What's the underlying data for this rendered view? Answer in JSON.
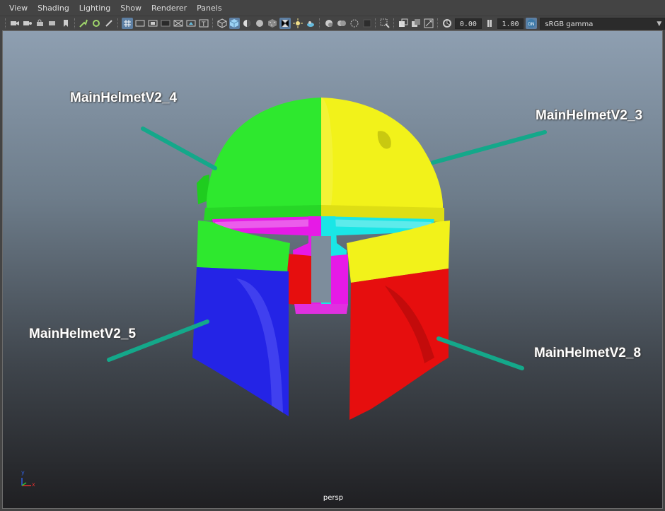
{
  "menubar": {
    "items": [
      "View",
      "Shading",
      "Lighting",
      "Show",
      "Renderer",
      "Panels"
    ]
  },
  "toolbar": {
    "exposure_value": "0.00",
    "gamma_value": "1.00",
    "color_space": "sRGB gamma",
    "icons": [
      "camera-icon",
      "camera-attributes-icon",
      "bookmark-icon",
      "image-plane-icon",
      "grid-icon",
      "film-gate-icon",
      "resolution-gate-icon",
      "gate-mask-icon",
      "field-chart-icon",
      "safe-action-icon",
      "safe-title-icon",
      "wireframe-icon",
      "smooth-shade-icon",
      "default-lighting-icon",
      "textured-icon",
      "use-all-lights-icon",
      "shadows-icon",
      "screen-space-ao-icon",
      "motion-blur-icon",
      "multisample-aa-icon",
      "depth-of-field-icon",
      "isolate-select-icon",
      "xray-icon",
      "xray-joints-icon",
      "backface-culling-icon",
      "exposure-icon",
      "gamma-icon",
      "color-management-icon"
    ]
  },
  "viewport": {
    "camera": "persp",
    "labels": {
      "helmet4": "MainHelmetV2_4",
      "helmet3": "MainHelmetV2_3",
      "helmet5": "MainHelmetV2_5",
      "helmet8": "MainHelmetV2_8"
    },
    "axis": {
      "x": "x",
      "y": "y"
    }
  },
  "colors": {
    "green": "#2ee82e",
    "yellow": "#f2f21a",
    "blue": "#2424e6",
    "red": "#e60e0e",
    "magenta": "#e61ae6",
    "cyan": "#1ae6e6",
    "pointer": "#14a88a"
  }
}
